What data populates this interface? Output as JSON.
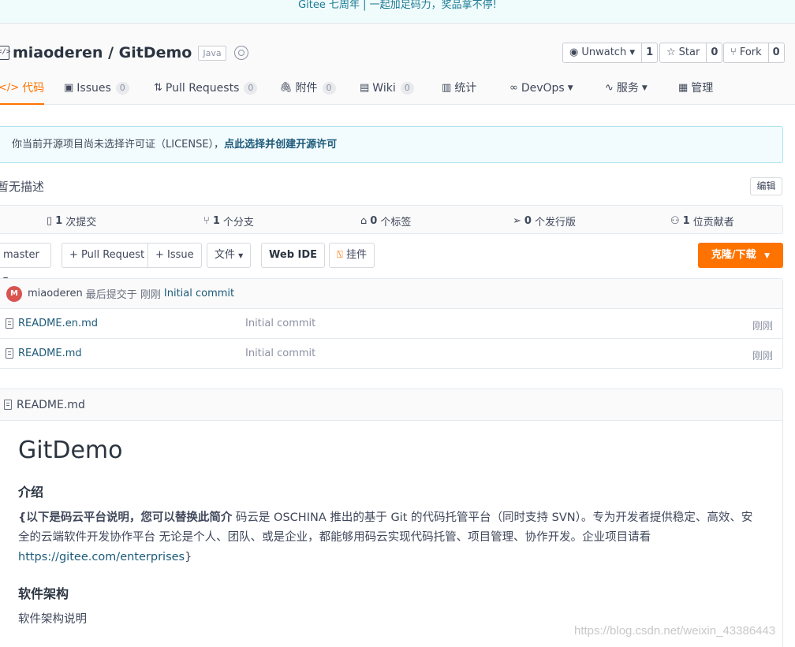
{
  "banner": {
    "text": "Gitee 七周年 | 一起加足码力，奖品拿不停!"
  },
  "repo": {
    "owner": "miaoderen",
    "separator": " / ",
    "name": "GitDemo",
    "language": "Java"
  },
  "actions": {
    "watch_label": "Unwatch",
    "watch_count": "1",
    "star_label": "Star",
    "star_count": "0",
    "fork_label": "Fork",
    "fork_count": "0"
  },
  "tabs": [
    {
      "label": "代码",
      "icon": "code-icon",
      "count": null
    },
    {
      "label": "Issues",
      "icon": "issue-icon",
      "count": "0"
    },
    {
      "label": "Pull Requests",
      "icon": "pull-request-icon",
      "count": "0"
    },
    {
      "label": "附件",
      "icon": "paperclip-icon",
      "count": "0"
    },
    {
      "label": "Wiki",
      "icon": "book-icon",
      "count": "0"
    },
    {
      "label": "统计",
      "icon": "bar-chart-icon",
      "count": null
    },
    {
      "label": "DevOps",
      "icon": "infinity-icon",
      "count": null
    },
    {
      "label": "服务",
      "icon": "pulse-icon",
      "count": null
    },
    {
      "label": "管理",
      "icon": "settings-doc-icon",
      "count": null
    }
  ],
  "license": {
    "text": "你当前开源项目尚未选择许可证（LICENSE），",
    "link": "点此选择并创建开源许可"
  },
  "description": {
    "text": "暂无描述",
    "edit_label": "编辑"
  },
  "stats": {
    "commits": {
      "count": "1",
      "label": "次提交"
    },
    "branches": {
      "count": "1",
      "label": "个分支"
    },
    "tags": {
      "count": "0",
      "label": "个标签"
    },
    "releases": {
      "count": "0",
      "label": "个发行版"
    },
    "contributors": {
      "count": "1",
      "label": "位贡献者"
    }
  },
  "toolbar": {
    "branch": "master",
    "pull_request": "+ Pull Request",
    "issue": "+ Issue",
    "file": "文件",
    "web_ide": "Web IDE",
    "widget": "挂件",
    "clone": "克隆/下载"
  },
  "last_commit": {
    "avatar_letter": "M",
    "author": "miaoderen",
    "text": "最后提交于 刚刚",
    "message": "Initial commit"
  },
  "files": [
    {
      "name": "README.en.md",
      "message": "Initial commit",
      "time": "刚刚"
    },
    {
      "name": "README.md",
      "message": "Initial commit",
      "time": "刚刚"
    }
  ],
  "readme": {
    "filename": "README.md",
    "title": "GitDemo",
    "intro_heading": "介绍",
    "intro_bold": "{以下是码云平台说明，您可以替换此简介",
    "intro_text": " 码云是 OSCHINA 推出的基于 Git 的代码托管平台（同时支持 SVN）。专为开发者提供稳定、高效、安全的云端软件开发协作平台 无论是个人、团队、或是企业，都能够用码云实现代码托管、项目管理、协作开发。企业项目请看 ",
    "intro_link": "https://gitee.com/enterprises",
    "intro_end": "}",
    "arch_heading": "软件架构",
    "arch_text": "软件架构说明"
  },
  "watermark": "https://blog.csdn.net/weixin_43386443"
}
